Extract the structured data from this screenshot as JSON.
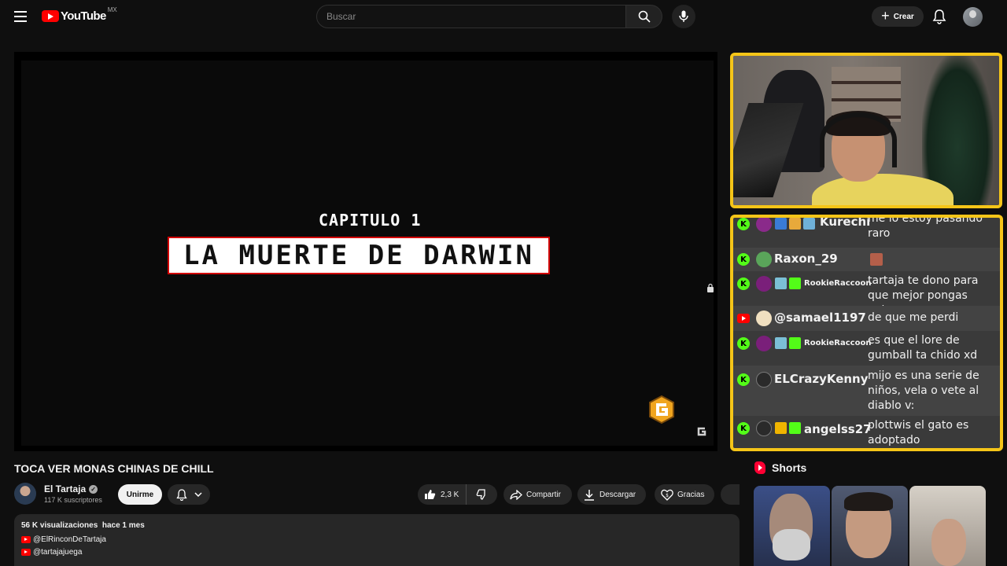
{
  "header": {
    "logo_text": "YouTube",
    "country_code": "MX",
    "search_placeholder": "Buscar",
    "create_label": "Crear"
  },
  "player": {
    "chapter_label": "CAPITULO 1",
    "episode_title": "LA MUERTE DE DARWIN"
  },
  "chat": {
    "top_partial": {
      "platform": "kick",
      "username": "Kurechi",
      "message": "me lo estoy pasando raro"
    },
    "messages": [
      {
        "platform": "kick",
        "username": "Raxon_29",
        "message": ""
      },
      {
        "platform": "kick",
        "username": "RookieRaccoon",
        "message": "tartaja te dono para que mejor pongas polno"
      },
      {
        "platform": "youtube",
        "username": "@samael1197",
        "message": "de que me perdi"
      },
      {
        "platform": "kick",
        "username": "RookieRaccoon",
        "message": "es que el lore de gumball ta chido xd"
      },
      {
        "platform": "kick",
        "username": "ELCrazyKenny",
        "message": "mijo es una serie de niños, vela o vete al diablo v:"
      },
      {
        "platform": "kick",
        "username": "angelss27",
        "message": "plottwis el gato es adoptado"
      }
    ]
  },
  "video": {
    "title": "TOCA VER MONAS CHINAS DE CHILL",
    "channel_name": "El Tartaja",
    "subscribers": "117 K suscriptores",
    "join_label": "Unirme",
    "likes": "2,3 K",
    "share_label": "Compartir",
    "download_label": "Descargar",
    "thanks_label": "Gracias",
    "views": "56 K visualizaciones",
    "published": "hace 1 mes",
    "desc_links": [
      "@ElRinconDeTartaja",
      "@tartajajuega"
    ]
  },
  "shorts": {
    "heading": "Shorts"
  },
  "colors": {
    "accent_red": "#ff0000",
    "overlay_border": "#f5c518",
    "kick_green": "#53fc18"
  }
}
